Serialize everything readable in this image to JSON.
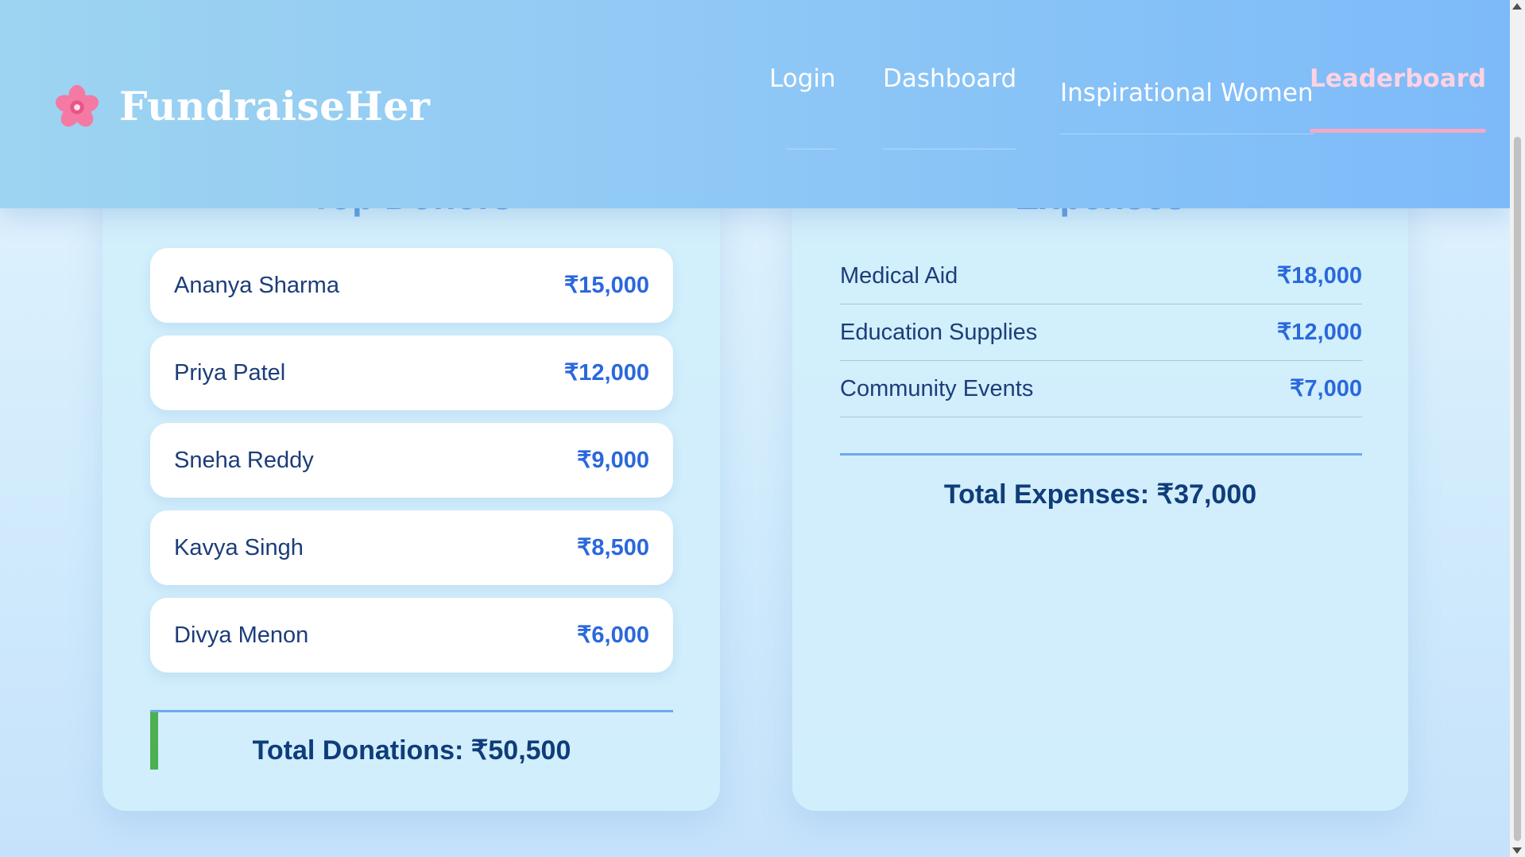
{
  "brand": {
    "name": "FundraiseHer",
    "icon": "cherry-blossom-icon"
  },
  "nav": {
    "items": [
      {
        "label": "Login"
      },
      {
        "label": "Dashboard"
      },
      {
        "label": "Inspirational Women"
      },
      {
        "label": "Leaderboard",
        "active": true
      }
    ]
  },
  "donors": {
    "title": "Top Donors",
    "items": [
      {
        "name": "Ananya Sharma",
        "amount": "₹15,000"
      },
      {
        "name": "Priya Patel",
        "amount": "₹12,000"
      },
      {
        "name": "Sneha Reddy",
        "amount": "₹9,000"
      },
      {
        "name": "Kavya Singh",
        "amount": "₹8,500"
      },
      {
        "name": "Divya Menon",
        "amount": "₹6,000"
      }
    ],
    "total": "Total Donations: ₹50,500"
  },
  "expenses": {
    "title": "Expenses",
    "items": [
      {
        "name": "Medical Aid",
        "amount": "₹18,000"
      },
      {
        "name": "Education Supplies",
        "amount": "₹12,000"
      },
      {
        "name": "Community Events",
        "amount": "₹7,000"
      }
    ],
    "total": "Total Expenses: ₹37,000"
  },
  "colors": {
    "accent": "#2a68dc",
    "active_nav": "#fcd3e3",
    "total_bar": "#4caf50"
  }
}
